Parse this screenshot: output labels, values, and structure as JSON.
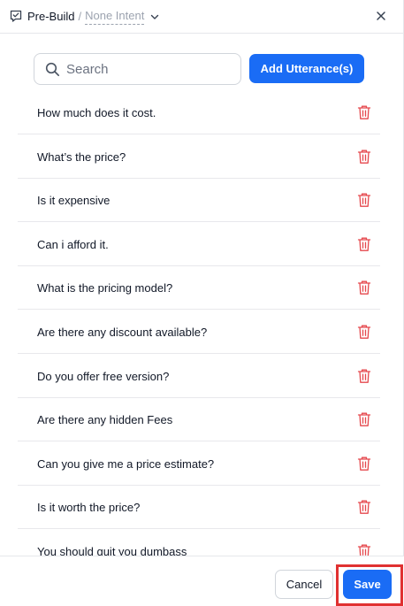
{
  "header": {
    "breadcrumb_main": "Pre-Build",
    "breadcrumb_separator": "/",
    "breadcrumb_intent": "None Intent",
    "icons": {
      "intent": "checkbox-speech-icon",
      "dropdown": "chevron-down-icon",
      "close": "close-icon"
    }
  },
  "search": {
    "placeholder": "Search",
    "value": ""
  },
  "add_button_label": "Add Utterance(s)",
  "utterances": [
    "How much does it cost.",
    "What’s the price?",
    "Is it expensive",
    "Can i afford it.",
    "What is the pricing model?",
    "Are there any discount available?",
    "Do you offer free version?",
    "Are there any hidden Fees",
    "Can you give me a price estimate?",
    "Is it worth the price?",
    "You should quit you dumbass"
  ],
  "row_action_icon": "trash-icon",
  "footer": {
    "cancel_label": "Cancel",
    "save_label": "Save"
  },
  "colors": {
    "primary": "#1a6cf5",
    "delete": "#e5484d",
    "highlight": "#e03131"
  }
}
